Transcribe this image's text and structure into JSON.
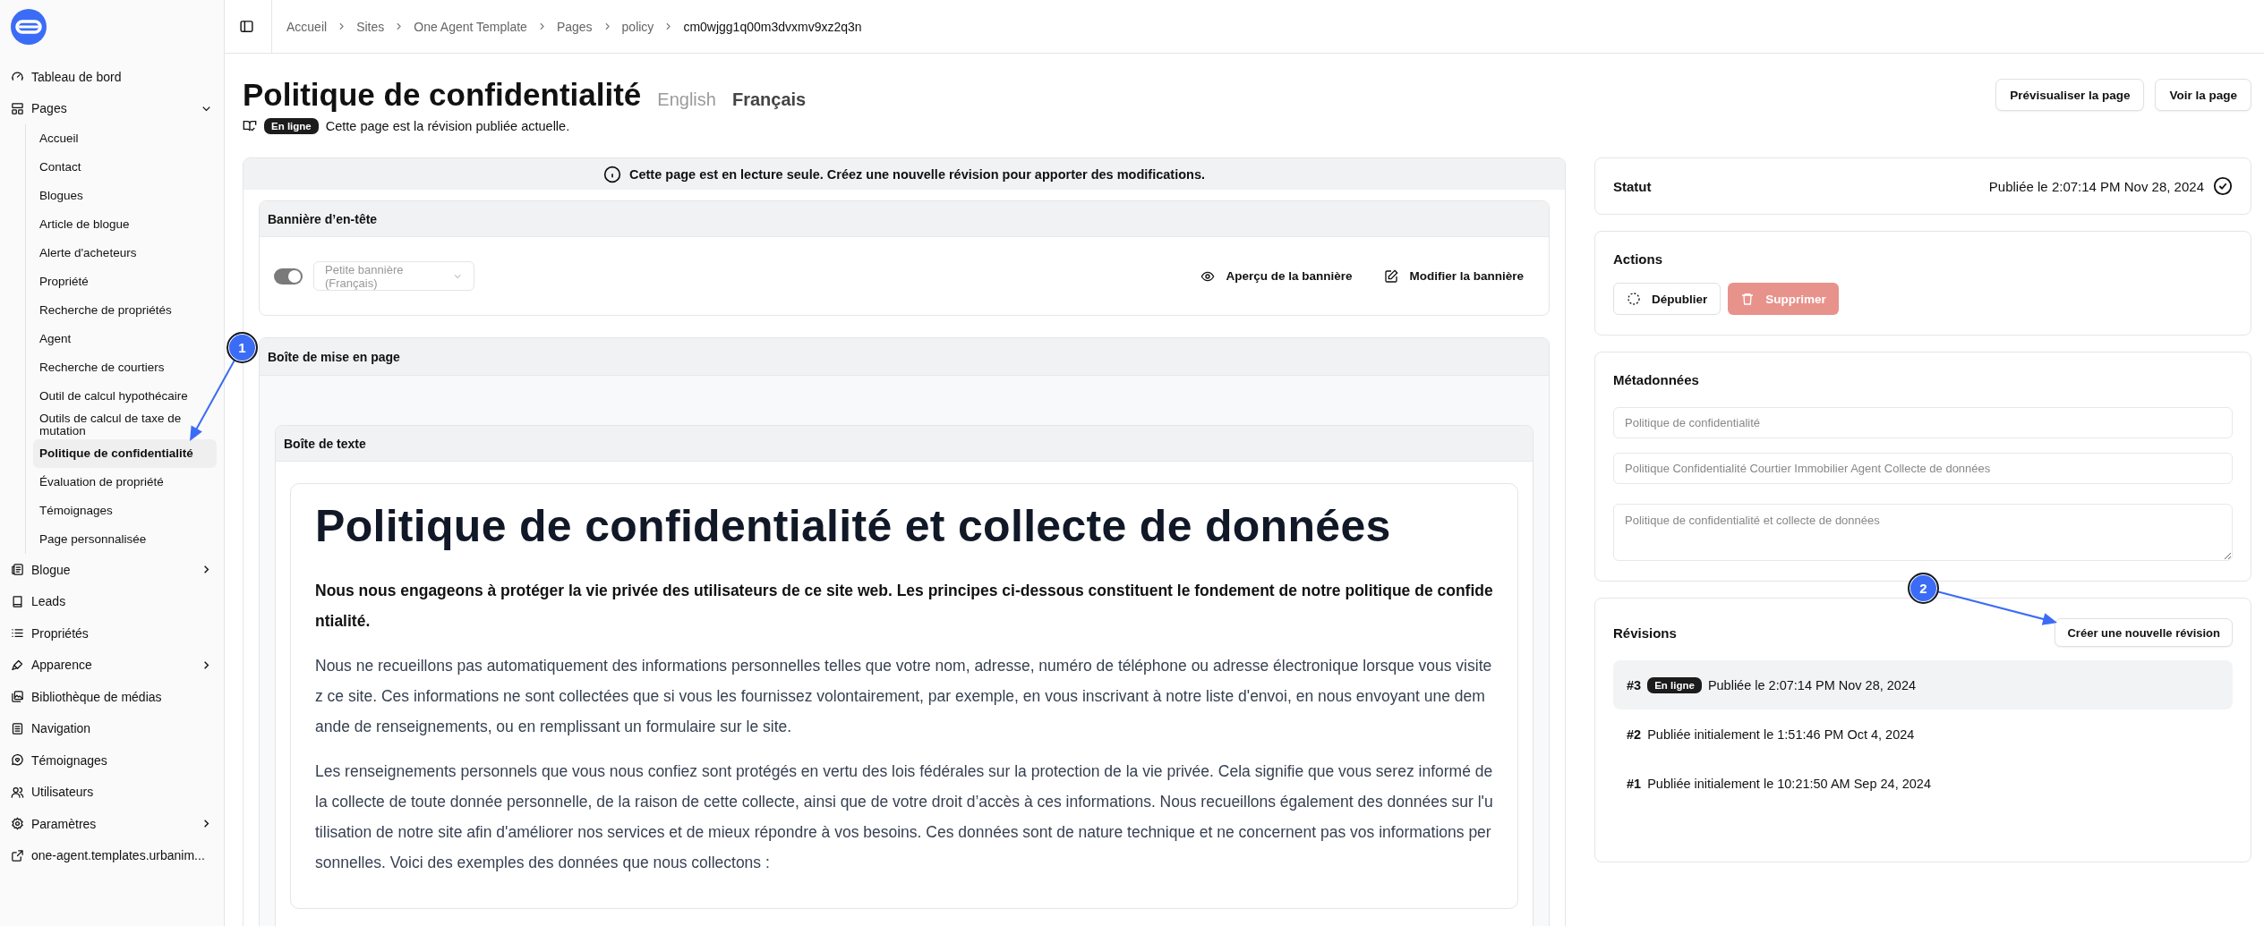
{
  "sidebar": {
    "items": [
      {
        "label": "Tableau de bord",
        "kind": "gauge"
      },
      {
        "label": "Pages",
        "kind": "layout",
        "expanded": true,
        "children": [
          {
            "label": "Accueil",
            "selected": false
          },
          {
            "label": "Contact",
            "selected": false
          },
          {
            "label": "Blogues",
            "selected": false
          },
          {
            "label": "Article de blogue",
            "selected": false
          },
          {
            "label": "Alerte d'acheteurs",
            "selected": false
          },
          {
            "label": "Propriété",
            "selected": false
          },
          {
            "label": "Recherche de propriétés",
            "selected": false
          },
          {
            "label": "Agent",
            "selected": false
          },
          {
            "label": "Recherche de courtiers",
            "selected": false
          },
          {
            "label": "Outil de calcul hypothécaire",
            "selected": false
          },
          {
            "label": "Outils de calcul de taxe de mutation",
            "selected": false
          },
          {
            "label": "Politique de confidentialité",
            "selected": true
          },
          {
            "label": "Évaluation de propriété",
            "selected": false
          },
          {
            "label": "Témoignages",
            "selected": false
          },
          {
            "label": "Page personnalisée",
            "selected": false
          }
        ]
      },
      {
        "label": "Blogue",
        "kind": "newspaper",
        "expanded": false
      },
      {
        "label": "Leads",
        "kind": "book"
      },
      {
        "label": "Propriétés",
        "kind": "list"
      },
      {
        "label": "Apparence",
        "kind": "brush",
        "expanded": false
      },
      {
        "label": "Bibliothèque de médias",
        "kind": "image"
      },
      {
        "label": "Navigation",
        "kind": "document"
      },
      {
        "label": "Témoignages",
        "kind": "chat"
      },
      {
        "label": "Utilisateurs",
        "kind": "users"
      },
      {
        "label": "Paramètres",
        "kind": "gear",
        "expanded": false
      },
      {
        "label": "one-agent.templates.urbanim...",
        "kind": "external"
      }
    ]
  },
  "breadcrumb": [
    "Accueil",
    "Sites",
    "One Agent Template",
    "Pages",
    "policy",
    "cm0wjgg1q00m3dvxmv9xz2q3n"
  ],
  "header": {
    "title": "Politique de confidentialité",
    "languages": [
      {
        "label": "English",
        "selected": false
      },
      {
        "label": "Français",
        "selected": true
      }
    ],
    "badge": "En ligne",
    "note": "Cette page est la révision publiée actuelle.",
    "buttons": [
      "Prévisualiser la page",
      "Voir la page"
    ]
  },
  "notice": "Cette page est en lecture seule. Créez une nouvelle révision pour apporter des modifications.",
  "banner_section": {
    "title": "Bannière d’en-tête",
    "toggle": {
      "on": true
    },
    "select": "Petite bannière (Français)",
    "actions": [
      {
        "label": "Aperçu de la bannière",
        "kind": "eye"
      },
      {
        "label": "Modifier la bannière",
        "kind": "edit"
      }
    ]
  },
  "layout_box": {
    "title": "Boîte de mise en page",
    "text_box": {
      "title": "Boîte de texte",
      "heading": "Politique de confidentialité et collecte de données",
      "lead": "Nous nous engageons à protéger la vie privée des utilisateurs de ce site web. Les principes ci-dessous constituent le fondement de notre politique de confidentialité.",
      "paragraphs": [
        "Nous ne recueillons pas automatiquement des informations personnelles telles que votre nom, adresse, numéro de téléphone ou adresse électronique lorsque vous visitez ce site. Ces informations ne sont collectées que si vous les fournissez volontairement, par exemple, en vous inscrivant à notre liste d'envoi, en nous envoyant une demande de renseignements, ou en remplissant un formulaire sur le site.",
        "Les renseignements personnels que vous nous confiez sont protégés en vertu des lois fédérales sur la protection de la vie privée. Cela signifie que vous serez informé de la collecte de toute donnée personnelle, de la raison de cette collecte, ainsi que de votre droit d’accès à ces informations. Nous recueillons également des données sur l'utilisation de notre site afin d'améliorer nos services et de mieux répondre à vos besoins. Ces données sont de nature technique et ne concernent pas vos informations personnelles. Voici des exemples des données que nous collectons :"
      ]
    }
  },
  "status": {
    "label": "Statut",
    "value": "Publiée le 2:07:14 PM Nov 28, 2024"
  },
  "actions": {
    "title": "Actions",
    "buttons": [
      {
        "label": "Dépublier",
        "kind": "outline",
        "disabled": false
      },
      {
        "label": "Supprimer",
        "kind": "danger",
        "disabled": true
      }
    ]
  },
  "metadata": {
    "title": "Métadonnées",
    "fields": [
      {
        "kind": "input",
        "placeholder": "Politique de confidentialité"
      },
      {
        "kind": "input",
        "placeholder": "Politique Confidentialité Courtier Immobilier Agent Collecte de données"
      },
      {
        "kind": "textarea",
        "placeholder": "Politique de confidentialité et collecte de données"
      }
    ]
  },
  "revisions": {
    "title": "Révisions",
    "create_button": "Créer une nouvelle révision",
    "items": [
      {
        "number": "#3",
        "badge": "En ligne",
        "text": "Publiée le 2:07:14 PM Nov 28, 2024",
        "selected": true
      },
      {
        "number": "#2",
        "text": "Publiée initialement le 1:51:46 PM Oct 4, 2024",
        "selected": false
      },
      {
        "number": "#1",
        "text": "Publiée initialement le 10:21:50 AM Sep 24, 2024",
        "selected": false
      }
    ]
  },
  "annotations": [
    {
      "label": "1"
    },
    {
      "label": "2"
    }
  ]
}
